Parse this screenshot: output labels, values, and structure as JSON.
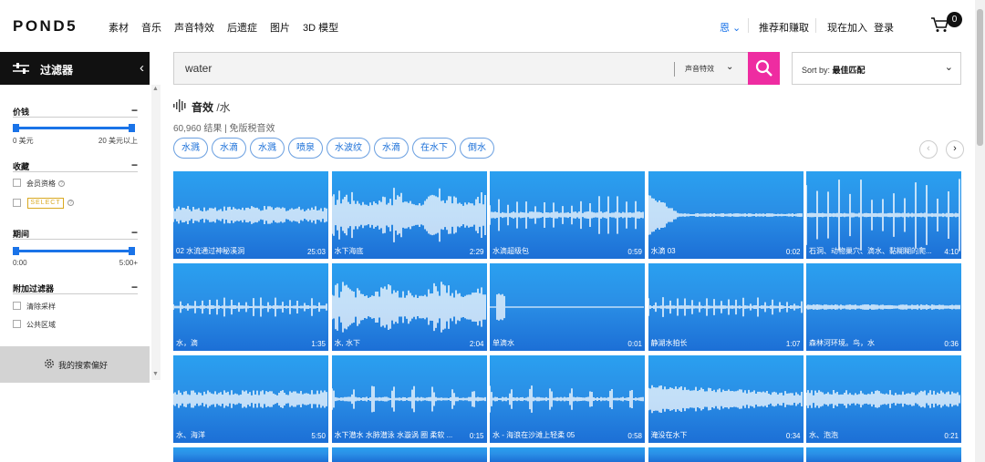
{
  "brand": {
    "logo": "POND5"
  },
  "nav": [
    "素材",
    "音乐",
    "声音特效",
    "后遗症",
    "图片",
    "3D 模型"
  ],
  "right_nav": {
    "lang": "恩",
    "sell": "推荐和赚取",
    "join": "现在加入",
    "login": "登录",
    "cart_count": "0"
  },
  "sidebar": {
    "title": "过滤器",
    "price": {
      "title": "价钱",
      "min": "0 美元",
      "max": "20 美元以上"
    },
    "collection": {
      "title": "收藏",
      "member": "会员资格",
      "select": "SELECT"
    },
    "duration": {
      "title": "期间",
      "min": "0:00",
      "max": "5:00+"
    },
    "extra": {
      "title": "附加过滤器",
      "clear": "清除采样",
      "public": "公共区域"
    },
    "prefs": "我的搜索偏好"
  },
  "search": {
    "value": "water",
    "category": "声音特效"
  },
  "sort": {
    "label": "Sort by:",
    "value": "最佳匹配"
  },
  "heading": {
    "title": "音效",
    "sub": " /水"
  },
  "results": "60,960 结果 | 免版税音效",
  "tags": [
    "水溅",
    "水滴",
    "水溅",
    "喷泉",
    "水波纹",
    "水滴",
    "在水下",
    "倒水"
  ],
  "tiles": [
    {
      "label": "02 水流通过神秘溪洞",
      "dur": "25:03",
      "shape": "band"
    },
    {
      "label": "水下海底",
      "dur": "2:29",
      "shape": "dense"
    },
    {
      "label": "水滴超级包",
      "dur": "0:59",
      "shape": "spikes"
    },
    {
      "label": "水滴 03",
      "dur": "0:02",
      "shape": "decay"
    },
    {
      "label": "石洞、动物巢穴、滴水、黏糊糊的爬...",
      "dur": "4:10",
      "shape": "sparse"
    },
    {
      "label": "水，滴",
      "dur": "1:35",
      "shape": "ticks"
    },
    {
      "label": "水, 水下",
      "dur": "2:04",
      "shape": "dense"
    },
    {
      "label": "单滴水",
      "dur": "0:01",
      "shape": "single"
    },
    {
      "label": "静湖水拍长",
      "dur": "1:07",
      "shape": "ticks"
    },
    {
      "label": "森林河环境。鸟，水",
      "dur": "0:36",
      "shape": "flat"
    },
    {
      "label": "水、海洋",
      "dur": "5:50",
      "shape": "band"
    },
    {
      "label": "水下潜水 水肺潜泳 水漩涡 圈 柔软 ...",
      "dur": "0:15",
      "shape": "bursts"
    },
    {
      "label": "水 - 海浪在沙滩上轻柔 05",
      "dur": "0:58",
      "shape": "bursts"
    },
    {
      "label": "淹没在水下",
      "dur": "0:34",
      "shape": "fadeband"
    },
    {
      "label": "水、泡泡",
      "dur": "0:21",
      "shape": "band"
    }
  ],
  "colors": {
    "accent": "#1a73e8",
    "search_button": "#ee2ca1",
    "tile": "#2a8fe6",
    "select_gold": "#d9a820"
  }
}
